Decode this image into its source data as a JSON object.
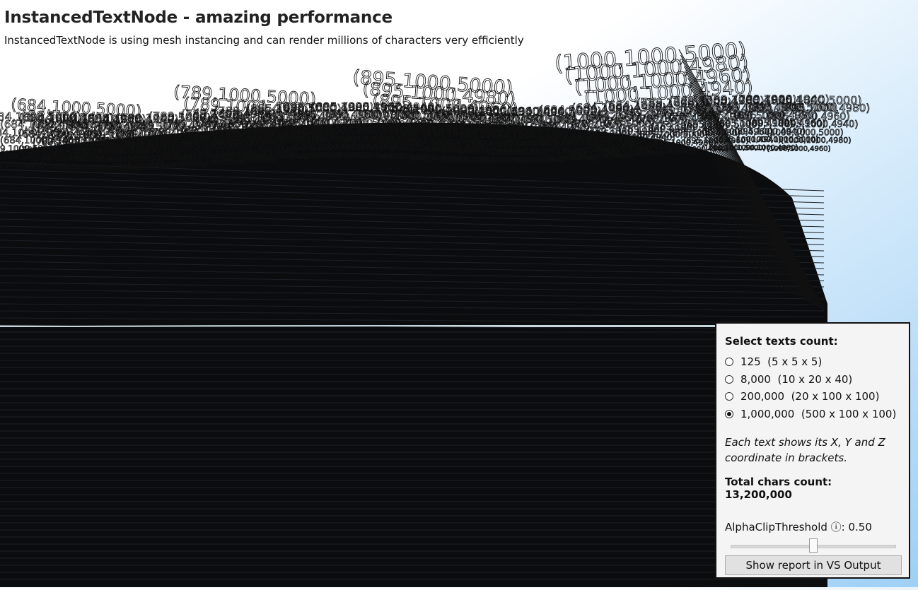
{
  "header": {
    "title": "InstancedTextNode - amazing performance",
    "subtitle": "InstancedTextNode is using mesh instancing and can render millions of characters very efficiently"
  },
  "scene": {
    "text_color": "#111111",
    "labels": [
      "(684,1000,5000)",
      "(684,1000,4980)",
      "(684,1000,4960)",
      "(684,1000,4940)",
      "(789,1000,5000)",
      "(789,1000,4980)",
      "(789,1000,4960)",
      "(789,1000,4940)",
      "(895,1000,5000)",
      "(895,1000,4980)",
      "(895,1000,4960)",
      "(895,1000,4940)",
      "(1000,1000,5000)",
      "(1000,1000,4980)",
      "(1000,1000,4960)",
      "(1000,1000,4940)"
    ]
  },
  "panel": {
    "heading": "Select texts count:",
    "options": [
      {
        "label": "125  (5 x 5 x 5)",
        "checked": false
      },
      {
        "label": "8,000  (10 x 20 x 40)",
        "checked": false
      },
      {
        "label": "200,000  (20 x 100 x 100)",
        "checked": false
      },
      {
        "label": "1,000,000  (500 x 100 x 100)",
        "checked": true
      }
    ],
    "note": "Each text shows its X, Y and Z coordinate in brackets.",
    "total": "Total chars count: 13,200,000",
    "slider_label": "AlphaClipThreshold ⓘ: 0.50",
    "alpha_clip_threshold": 0.5,
    "report_button": "Show report in VS Output"
  }
}
